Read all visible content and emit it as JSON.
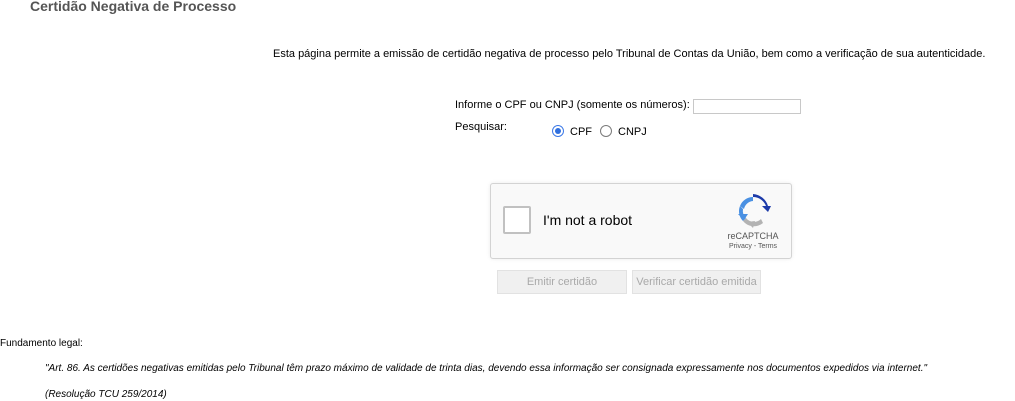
{
  "page": {
    "title": "Certidão Negativa de Processo",
    "intro": "Esta página permite a emissão de certidão negativa de processo pelo Tribunal de Contas da União, bem como a verificação de sua autenticidade."
  },
  "form": {
    "cpf_label": "Informe o CPF ou CNPJ (somente os números):",
    "cpf_value": "",
    "search_label": "Pesquisar:",
    "options": [
      {
        "label": "CPF",
        "selected": true
      },
      {
        "label": "CNPJ",
        "selected": false
      }
    ]
  },
  "captcha": {
    "label": "I'm not a robot",
    "brand": "reCAPTCHA",
    "links": "Privacy - Terms",
    "colors": {
      "blue": "#4a90e2",
      "dark_blue": "#1c3aa9",
      "gray": "#b3b3b3"
    }
  },
  "buttons": {
    "emit": "Emitir certidão",
    "verify": "Verificar certidão emitida"
  },
  "legal": {
    "label": "Fundamento legal:",
    "quote": "\"Art. 86. As certidões negativas emitidas pelo Tribunal têm prazo máximo de validade de trinta dias, devendo essa informação ser consignada expressamente nos documentos expedidos via internet.\"",
    "reference": "(Resolução TCU 259/2014)"
  }
}
